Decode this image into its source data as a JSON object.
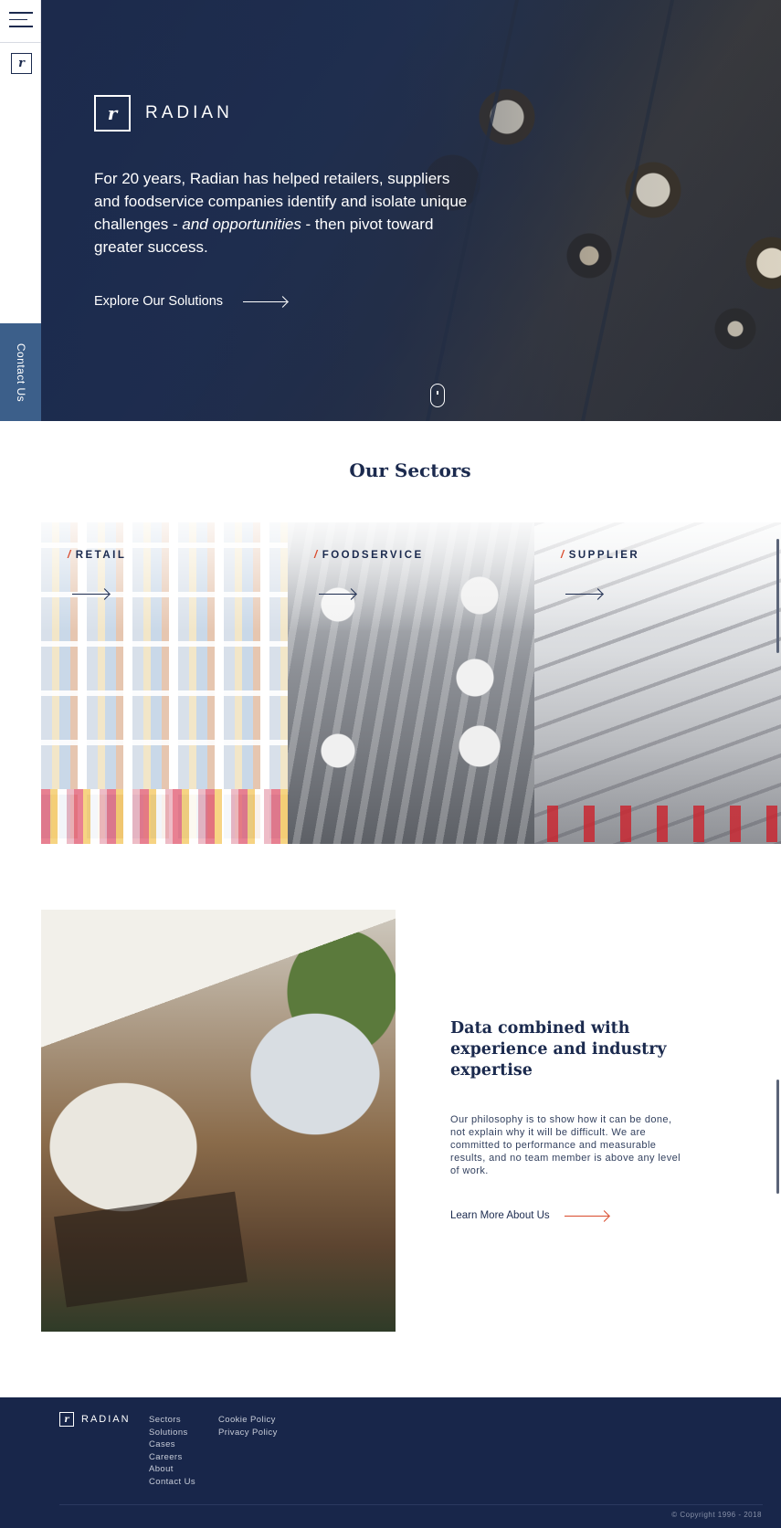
{
  "brand": {
    "name": "RADIAN",
    "logo_glyph": "r"
  },
  "nav": {
    "contact_tab": "Contact Us"
  },
  "hero": {
    "text_before": "For 20 years, Radian has helped retailers, suppliers and foodservice companies identify and isolate unique challenges - ",
    "text_emphasis": "and opportunities",
    "text_after": " - then pivot toward greater success.",
    "cta_label": "Explore Our Solutions"
  },
  "sectors": {
    "title": "Our Sectors",
    "items": [
      {
        "label": "RETAIL"
      },
      {
        "label": "FOODSERVICE"
      },
      {
        "label": "SUPPLIER"
      }
    ],
    "slash": "/"
  },
  "about": {
    "title": "Data combined with experience and industry expertise",
    "body": "Our philosophy is to show how it can be done, not explain why it will be difficult. We are committed to performance and measurable results, and no team member is above any level of work.",
    "cta_label": "Learn More About Us"
  },
  "footer": {
    "brand": "RADIAN",
    "col1": [
      "Sectors",
      "Solutions",
      "Cases",
      "Careers",
      "About",
      "Contact Us"
    ],
    "col2": [
      "Cookie Policy",
      "Privacy Policy"
    ],
    "copyright": "© Copyright 1996 - 2018"
  },
  "colors": {
    "navy": "#1b2a4e",
    "footer_bg": "#18264a",
    "accent": "#d94a2b",
    "contact_tab": "#3c5f8a"
  },
  "icons": [
    "menu-icon",
    "logo-mark-icon",
    "arrow-right-icon",
    "scroll-mouse-icon"
  ]
}
